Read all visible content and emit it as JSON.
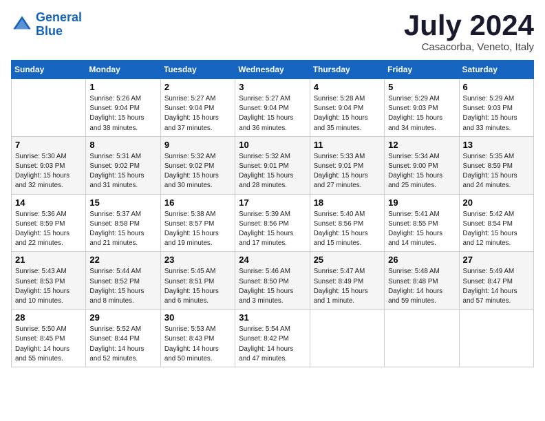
{
  "logo": {
    "line1": "General",
    "line2": "Blue"
  },
  "title": "July 2024",
  "location": "Casacorba, Veneto, Italy",
  "days_header": [
    "Sunday",
    "Monday",
    "Tuesday",
    "Wednesday",
    "Thursday",
    "Friday",
    "Saturday"
  ],
  "weeks": [
    [
      {
        "num": "",
        "info": ""
      },
      {
        "num": "1",
        "info": "Sunrise: 5:26 AM\nSunset: 9:04 PM\nDaylight: 15 hours\nand 38 minutes."
      },
      {
        "num": "2",
        "info": "Sunrise: 5:27 AM\nSunset: 9:04 PM\nDaylight: 15 hours\nand 37 minutes."
      },
      {
        "num": "3",
        "info": "Sunrise: 5:27 AM\nSunset: 9:04 PM\nDaylight: 15 hours\nand 36 minutes."
      },
      {
        "num": "4",
        "info": "Sunrise: 5:28 AM\nSunset: 9:04 PM\nDaylight: 15 hours\nand 35 minutes."
      },
      {
        "num": "5",
        "info": "Sunrise: 5:29 AM\nSunset: 9:03 PM\nDaylight: 15 hours\nand 34 minutes."
      },
      {
        "num": "6",
        "info": "Sunrise: 5:29 AM\nSunset: 9:03 PM\nDaylight: 15 hours\nand 33 minutes."
      }
    ],
    [
      {
        "num": "7",
        "info": "Sunrise: 5:30 AM\nSunset: 9:03 PM\nDaylight: 15 hours\nand 32 minutes."
      },
      {
        "num": "8",
        "info": "Sunrise: 5:31 AM\nSunset: 9:02 PM\nDaylight: 15 hours\nand 31 minutes."
      },
      {
        "num": "9",
        "info": "Sunrise: 5:32 AM\nSunset: 9:02 PM\nDaylight: 15 hours\nand 30 minutes."
      },
      {
        "num": "10",
        "info": "Sunrise: 5:32 AM\nSunset: 9:01 PM\nDaylight: 15 hours\nand 28 minutes."
      },
      {
        "num": "11",
        "info": "Sunrise: 5:33 AM\nSunset: 9:01 PM\nDaylight: 15 hours\nand 27 minutes."
      },
      {
        "num": "12",
        "info": "Sunrise: 5:34 AM\nSunset: 9:00 PM\nDaylight: 15 hours\nand 25 minutes."
      },
      {
        "num": "13",
        "info": "Sunrise: 5:35 AM\nSunset: 8:59 PM\nDaylight: 15 hours\nand 24 minutes."
      }
    ],
    [
      {
        "num": "14",
        "info": "Sunrise: 5:36 AM\nSunset: 8:59 PM\nDaylight: 15 hours\nand 22 minutes."
      },
      {
        "num": "15",
        "info": "Sunrise: 5:37 AM\nSunset: 8:58 PM\nDaylight: 15 hours\nand 21 minutes."
      },
      {
        "num": "16",
        "info": "Sunrise: 5:38 AM\nSunset: 8:57 PM\nDaylight: 15 hours\nand 19 minutes."
      },
      {
        "num": "17",
        "info": "Sunrise: 5:39 AM\nSunset: 8:56 PM\nDaylight: 15 hours\nand 17 minutes."
      },
      {
        "num": "18",
        "info": "Sunrise: 5:40 AM\nSunset: 8:56 PM\nDaylight: 15 hours\nand 15 minutes."
      },
      {
        "num": "19",
        "info": "Sunrise: 5:41 AM\nSunset: 8:55 PM\nDaylight: 15 hours\nand 14 minutes."
      },
      {
        "num": "20",
        "info": "Sunrise: 5:42 AM\nSunset: 8:54 PM\nDaylight: 15 hours\nand 12 minutes."
      }
    ],
    [
      {
        "num": "21",
        "info": "Sunrise: 5:43 AM\nSunset: 8:53 PM\nDaylight: 15 hours\nand 10 minutes."
      },
      {
        "num": "22",
        "info": "Sunrise: 5:44 AM\nSunset: 8:52 PM\nDaylight: 15 hours\nand 8 minutes."
      },
      {
        "num": "23",
        "info": "Sunrise: 5:45 AM\nSunset: 8:51 PM\nDaylight: 15 hours\nand 6 minutes."
      },
      {
        "num": "24",
        "info": "Sunrise: 5:46 AM\nSunset: 8:50 PM\nDaylight: 15 hours\nand 3 minutes."
      },
      {
        "num": "25",
        "info": "Sunrise: 5:47 AM\nSunset: 8:49 PM\nDaylight: 15 hours\nand 1 minute."
      },
      {
        "num": "26",
        "info": "Sunrise: 5:48 AM\nSunset: 8:48 PM\nDaylight: 14 hours\nand 59 minutes."
      },
      {
        "num": "27",
        "info": "Sunrise: 5:49 AM\nSunset: 8:47 PM\nDaylight: 14 hours\nand 57 minutes."
      }
    ],
    [
      {
        "num": "28",
        "info": "Sunrise: 5:50 AM\nSunset: 8:45 PM\nDaylight: 14 hours\nand 55 minutes."
      },
      {
        "num": "29",
        "info": "Sunrise: 5:52 AM\nSunset: 8:44 PM\nDaylight: 14 hours\nand 52 minutes."
      },
      {
        "num": "30",
        "info": "Sunrise: 5:53 AM\nSunset: 8:43 PM\nDaylight: 14 hours\nand 50 minutes."
      },
      {
        "num": "31",
        "info": "Sunrise: 5:54 AM\nSunset: 8:42 PM\nDaylight: 14 hours\nand 47 minutes."
      },
      {
        "num": "",
        "info": ""
      },
      {
        "num": "",
        "info": ""
      },
      {
        "num": "",
        "info": ""
      }
    ]
  ]
}
